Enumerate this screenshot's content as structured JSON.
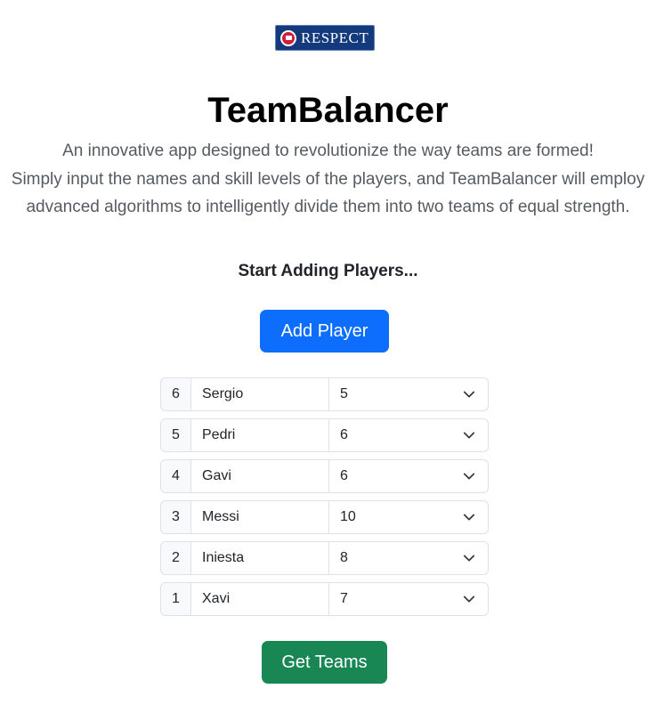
{
  "logo": {
    "text": "RESPECT",
    "icon": "uefa-respect-emblem"
  },
  "header": {
    "title": "TeamBalancer",
    "lead_lines": [
      "An innovative app designed to revolutionize the way teams are formed!",
      "Simply input the names and skill levels of the players, and TeamBalancer will employ",
      "advanced algorithms to intelligently divide them into two teams of equal strength."
    ]
  },
  "section": {
    "heading": "Start Adding Players..."
  },
  "buttons": {
    "add_player": "Add Player",
    "get_teams": "Get Teams"
  },
  "players": [
    {
      "index": "6",
      "name": "Sergio",
      "skill": "5"
    },
    {
      "index": "5",
      "name": "Pedri",
      "skill": "6"
    },
    {
      "index": "4",
      "name": "Gavi",
      "skill": "6"
    },
    {
      "index": "3",
      "name": "Messi",
      "skill": "10"
    },
    {
      "index": "2",
      "name": "Iniesta",
      "skill": "8"
    },
    {
      "index": "1",
      "name": "Xavi",
      "skill": "7"
    }
  ],
  "icons": {
    "select_arrow": "chevron-down-icon"
  },
  "colors": {
    "primary": "#0d6efd",
    "success": "#198754",
    "logo_bg": "#123a7c",
    "logo_emblem": "#d01f3c"
  }
}
